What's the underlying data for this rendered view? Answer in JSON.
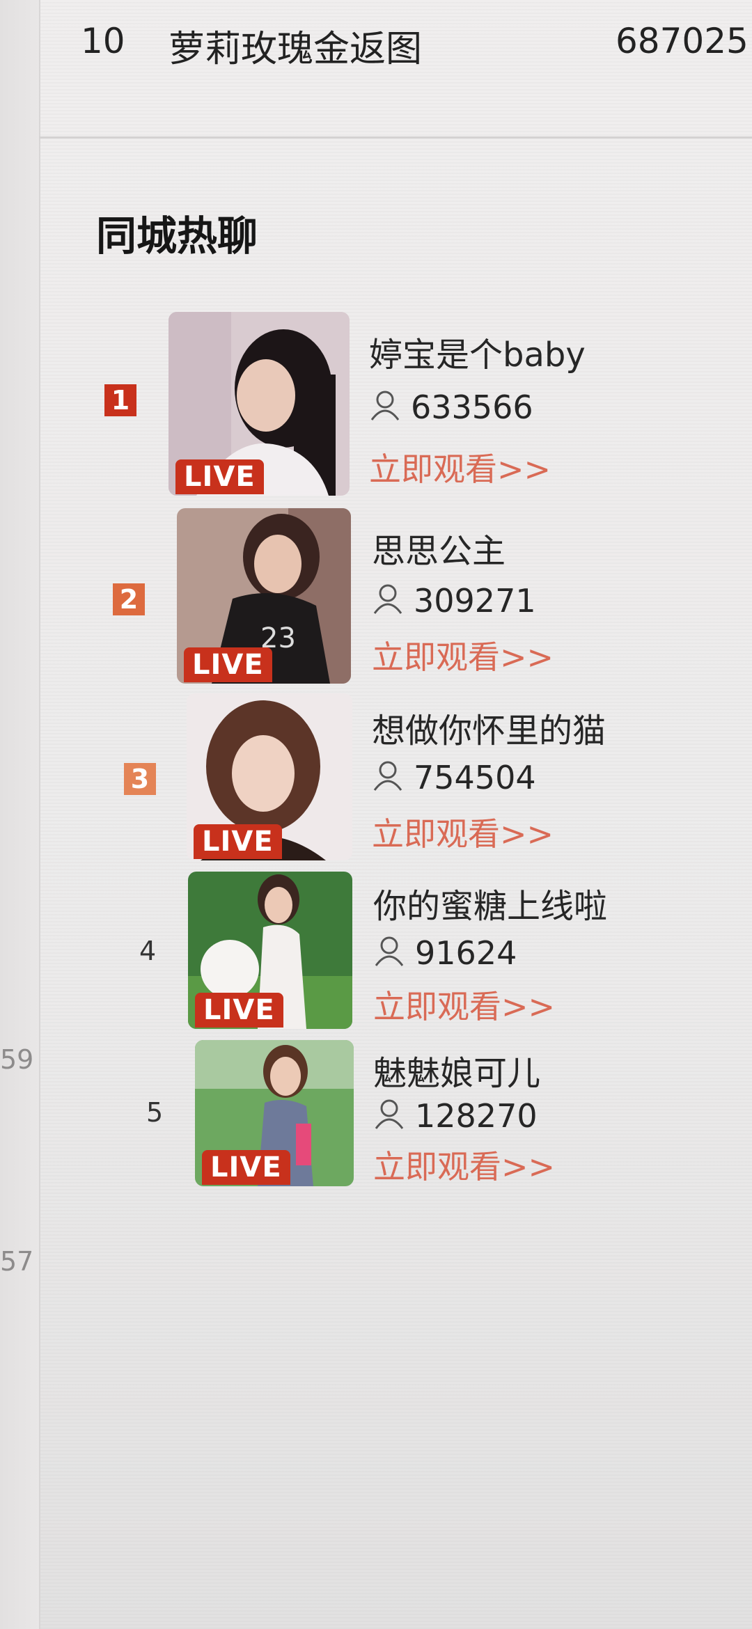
{
  "top_row": {
    "rank": "10",
    "name": "萝莉玫瑰金返图",
    "count": "687025"
  },
  "left_numbers": [
    "59",
    "57"
  ],
  "section_title": "同城热聊",
  "live_badge": "LIVE",
  "watch_label": "立即观看>>",
  "colors": {
    "rank1": "#c8311c",
    "rank2": "#dd6a3e",
    "rank3": "#e48456",
    "watch": "#d96a55",
    "live": "#c8311c"
  },
  "items": [
    {
      "rank": "1",
      "name": "婷宝是个baby",
      "viewers": "633566"
    },
    {
      "rank": "2",
      "name": "思思公主",
      "viewers": "309271"
    },
    {
      "rank": "3",
      "name": "想做你怀里的猫",
      "viewers": "754504"
    },
    {
      "rank": "4",
      "name": "你的蜜糖上线啦",
      "viewers": "91624"
    },
    {
      "rank": "5",
      "name": "魅魅娘可儿",
      "viewers": "128270"
    }
  ],
  "icons": {
    "viewer": "person-icon"
  }
}
